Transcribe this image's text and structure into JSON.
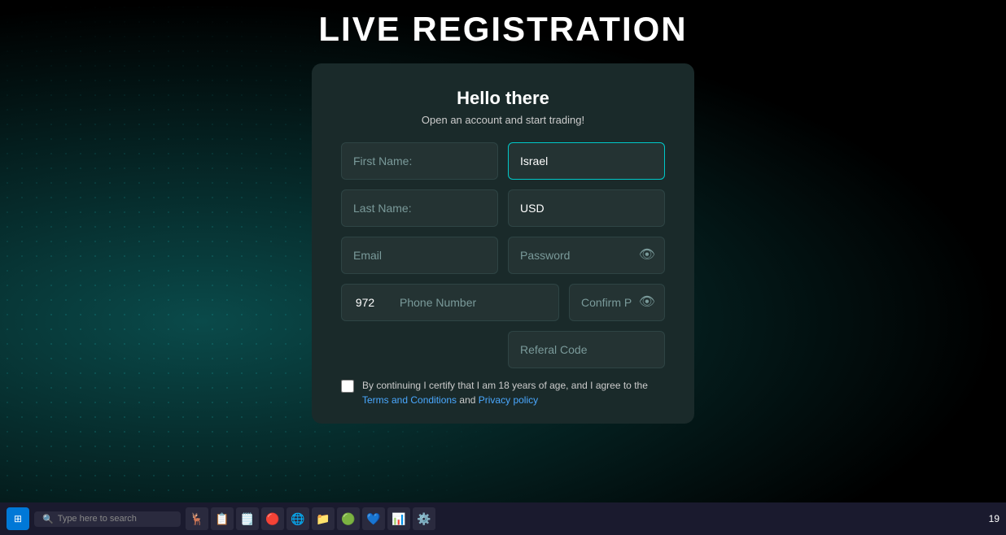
{
  "page": {
    "title": "LIVE REGISTRATION",
    "background_color": "#000"
  },
  "form": {
    "heading": "Hello there",
    "subheading": "Open an account and start trading!",
    "fields": {
      "first_name_placeholder": "First Name:",
      "last_name_placeholder": "Last Name:",
      "email_placeholder": "Email",
      "password_placeholder": "Password",
      "phone_code": "972",
      "phone_placeholder": "Phone Number",
      "confirm_password_placeholder": "Confirm Password",
      "referral_placeholder": "Referal Code",
      "country_value": "Israel",
      "currency_value": "USD"
    },
    "terms_text_prefix": "By continuing I certify that I am 18 years of age, and I agree to the ",
    "terms_link1": "Terms and Conditions",
    "terms_text_middle": " and ",
    "terms_link2": "Privacy policy",
    "terms_text_suffix": "."
  },
  "icons": {
    "eye": "👁",
    "search": "🔍"
  },
  "taskbar": {
    "time": "19",
    "search_placeholder": "Type here to search"
  }
}
